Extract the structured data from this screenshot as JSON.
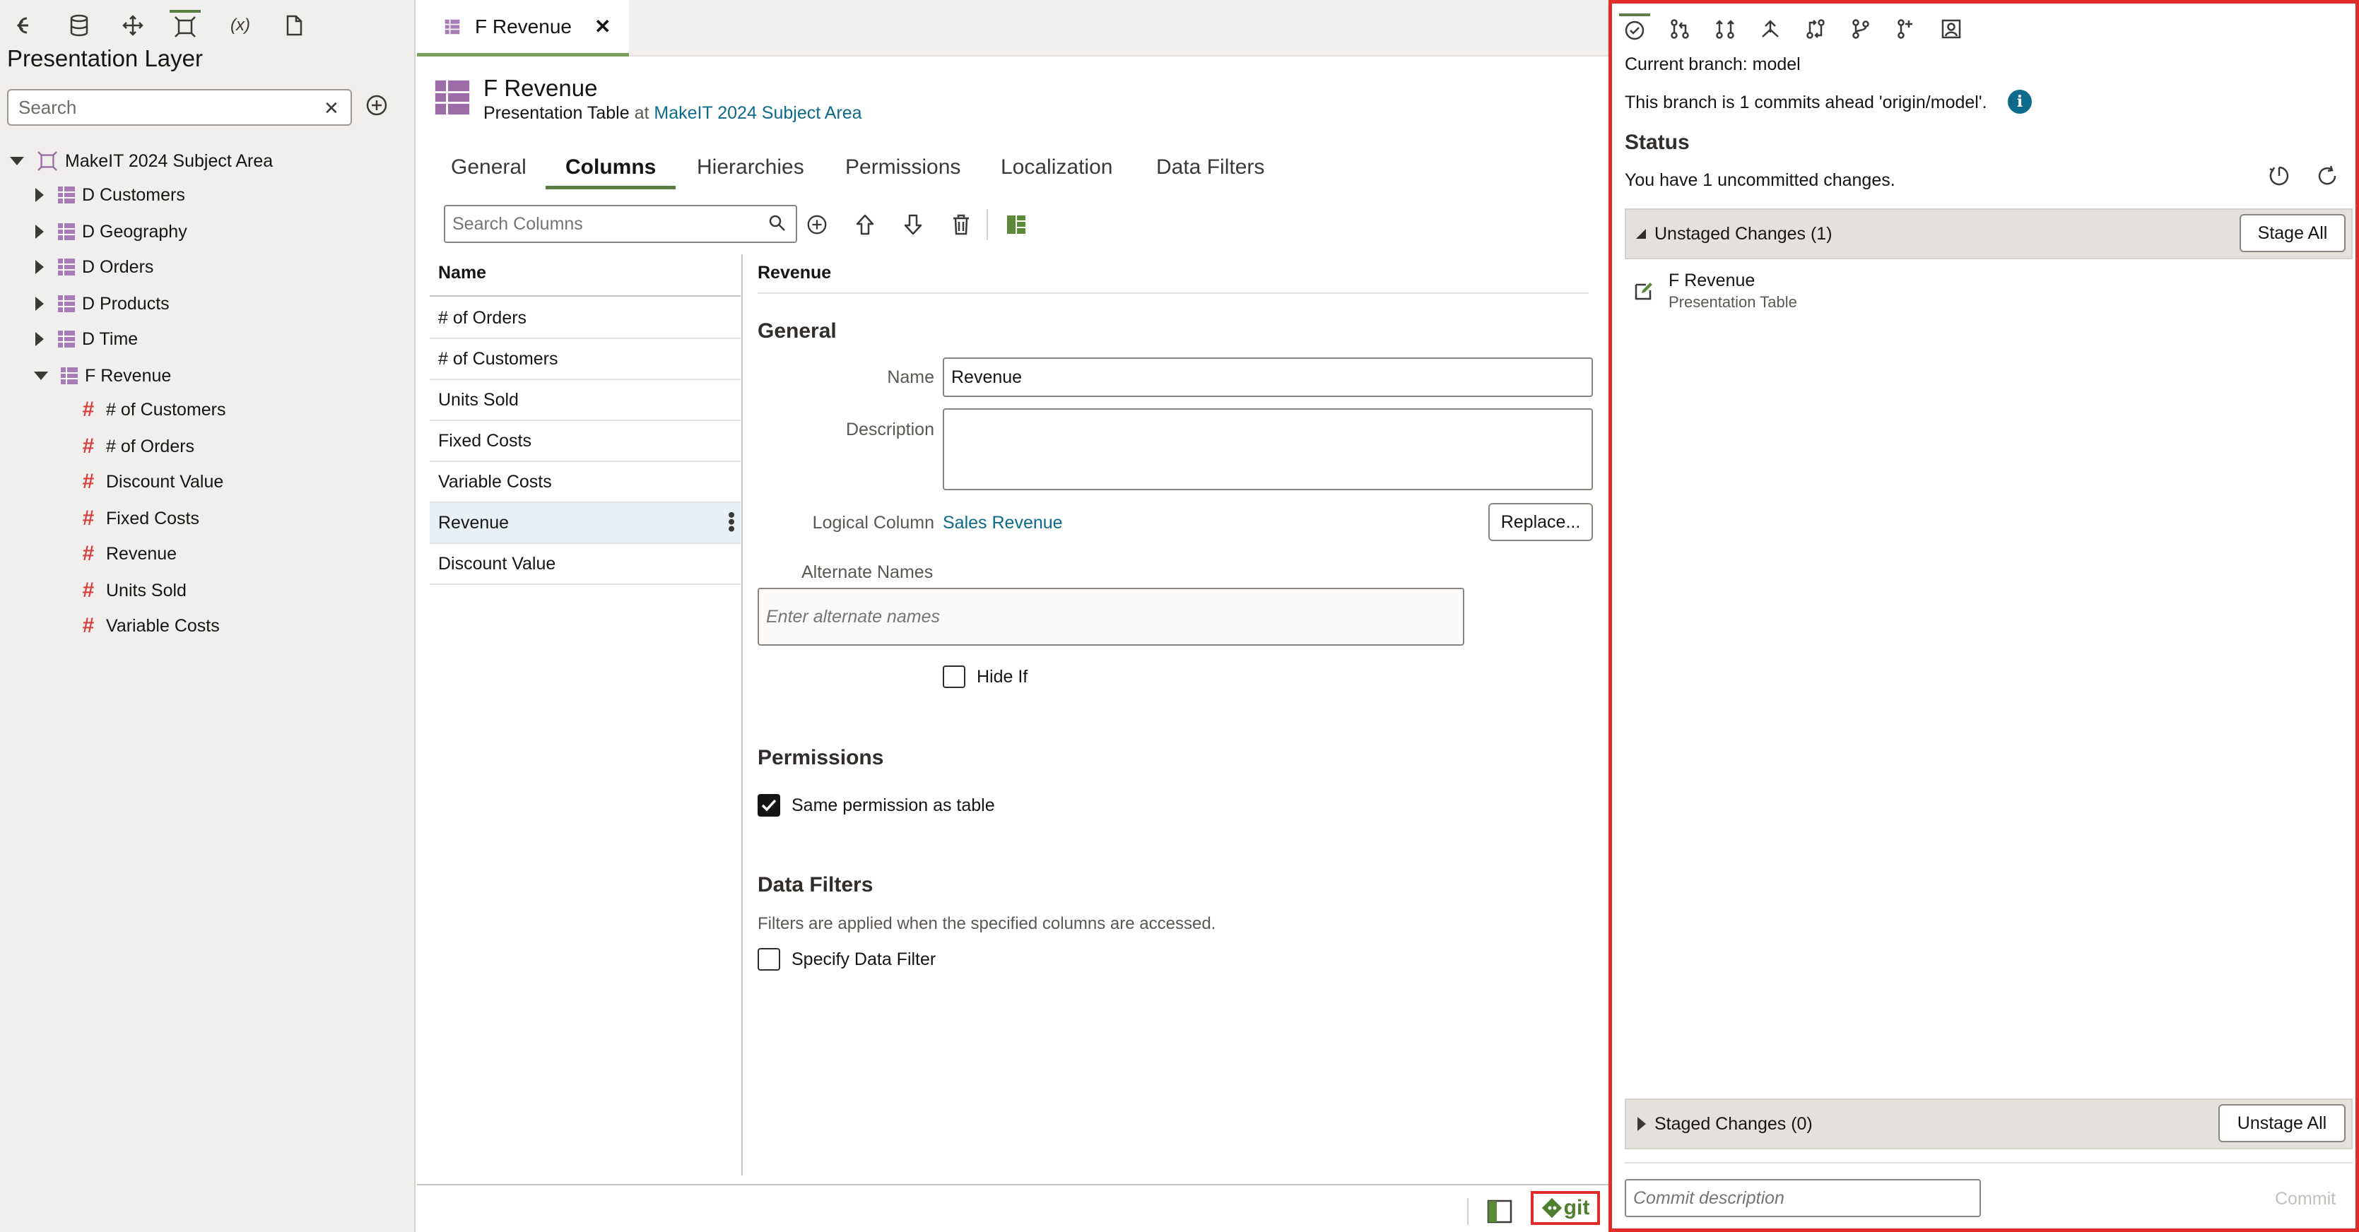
{
  "left": {
    "title": "Presentation Layer",
    "search_placeholder": "Search",
    "tree": {
      "root": "MakeIT 2024 Subject Area",
      "tables": [
        "D Customers",
        "D Geography",
        "D Orders",
        "D Products",
        "D Time"
      ],
      "expanded": "F Revenue",
      "columns": [
        "# of Customers",
        "# of Orders",
        "Discount Value",
        "Fixed Costs",
        "Revenue",
        "Units Sold",
        "Variable Costs"
      ]
    }
  },
  "center": {
    "tab_title": "F Revenue",
    "object_title": "F Revenue",
    "object_type": "Presentation Table",
    "at_word": "at",
    "subject_area_link": "MakeIT 2024 Subject Area",
    "tabs": [
      "General",
      "Columns",
      "Hierarchies",
      "Permissions",
      "Localization",
      "Data Filters"
    ],
    "search_columns_placeholder": "Search Columns",
    "list_header": "Name",
    "columns": [
      "# of Orders",
      "# of Customers",
      "Units Sold",
      "Fixed Costs",
      "Variable Costs",
      "Revenue",
      "Discount Value"
    ],
    "detail": {
      "header": "Revenue",
      "general_title": "General",
      "name_label": "Name",
      "name_value": "Revenue",
      "description_label": "Description",
      "description_value": "",
      "logical_column_label": "Logical Column",
      "logical_column_value": "Sales Revenue",
      "replace_button": "Replace...",
      "alternate_names_label": "Alternate Names",
      "alternate_names_placeholder": "Enter alternate names",
      "hide_if_label": "Hide If",
      "permissions_title": "Permissions",
      "same_permission_label": "Same permission as table",
      "data_filters_title": "Data Filters",
      "data_filters_desc": "Filters are applied when the specified columns are accessed.",
      "specify_filter_label": "Specify Data Filter"
    },
    "git_label": "git"
  },
  "git": {
    "current_branch": "Current branch: model",
    "ahead_text": "This branch is 1 commits ahead 'origin/model'.",
    "status_title": "Status",
    "uncommitted_text": "You have 1 uncommitted changes.",
    "unstaged_label": "Unstaged Changes (1)",
    "stage_all": "Stage All",
    "change_item": {
      "name": "F Revenue",
      "type": "Presentation Table"
    },
    "staged_label": "Staged Changes (0)",
    "unstage_all": "Unstage All",
    "commit_placeholder": "Commit description",
    "commit_button": "Commit"
  }
}
